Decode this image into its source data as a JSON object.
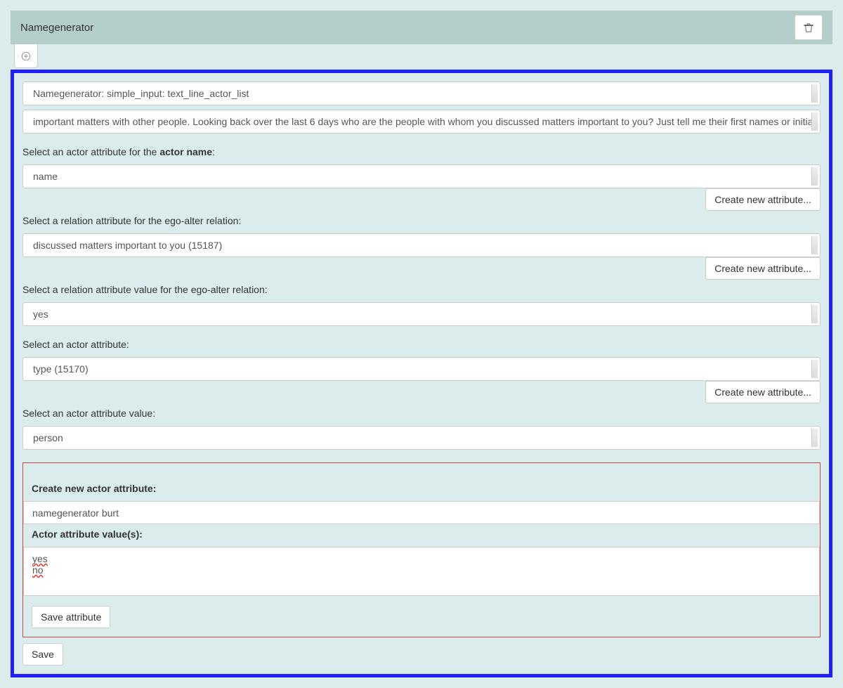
{
  "header": {
    "title": "Namegenerator"
  },
  "form": {
    "generator_type": "Namegenerator: simple_input: text_line_actor_list",
    "prompt_text": "important matters with other people. Looking back over the last 6 days who are the people with whom you discussed matters important to you? Just tell me their first names or initia",
    "actor_name_label_prefix": "Select an actor attribute for the ",
    "actor_name_label_bold": "actor name",
    "actor_name_label_suffix": ":",
    "actor_name_value": "name",
    "relation_attribute_label": "Select a relation attribute for the ego-alter relation:",
    "relation_attribute_value": "discussed matters important to you (15187)",
    "relation_value_label": "Select a relation attribute value for the ego-alter relation:",
    "relation_value_value": "yes",
    "actor_attr_label": "Select an actor attribute:",
    "actor_attr_value": "type (15170)",
    "actor_attr_value_label": "Select an actor attribute value:",
    "actor_attr_value_value": "person",
    "create_new_attr_button": "Create new attribute..."
  },
  "create_panel": {
    "title": "Create new actor attribute:",
    "name_value": "namegenerator burt",
    "values_label": "Actor attribute value(s):",
    "values_line1": "yes",
    "values_line2": "no",
    "save_attr_button": "Save attribute"
  },
  "footer": {
    "save_button": "Save"
  }
}
